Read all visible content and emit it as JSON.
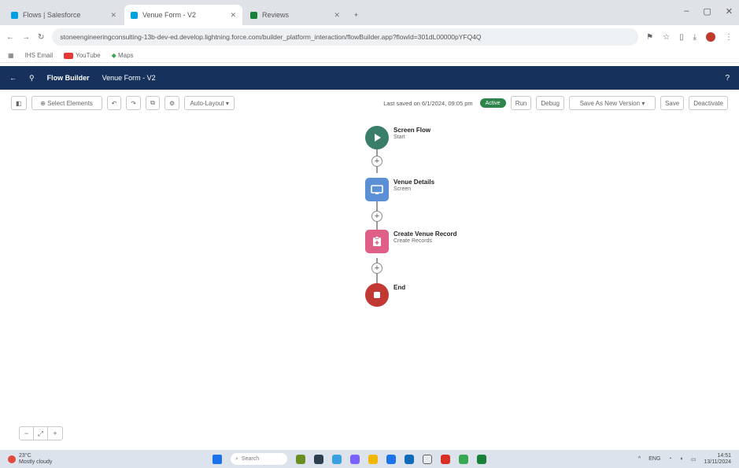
{
  "browser": {
    "tabs": [
      {
        "label": "Flows | Salesforce",
        "active": false
      },
      {
        "label": "Venue Form - V2",
        "active": true
      },
      {
        "label": "Reviews",
        "active": false
      }
    ],
    "new_tab": "+",
    "url": "stoneengineeringconsulting-13b-dev-ed.develop.lightning.force.com/builder_platform_interaction/flowBuilder.app?flowId=301dL00000pYFQ4Q",
    "bookmarks": [
      "IHS Email",
      "YouTube",
      "Maps"
    ]
  },
  "flow_builder": {
    "app_name": "Flow Builder",
    "flow_name": "Venue Form - V2",
    "help": "?"
  },
  "toolbar": {
    "select_elements": "Select Elements",
    "auto_layout": "Auto-Layout",
    "last_saved": "Last saved on 6/1/2024, 09:05 pm",
    "status": "Active",
    "run": "Run",
    "debug": "Debug",
    "save_as": "Save As New Version",
    "save": "Save",
    "deactivate": "Deactivate"
  },
  "canvas": {
    "nodes": [
      {
        "label": "Screen Flow",
        "sub": "Start"
      },
      {
        "label": "Venue Details",
        "sub": "Screen"
      },
      {
        "label": "Create Venue Record",
        "sub": "Create Records"
      },
      {
        "label": "End",
        "sub": ""
      }
    ],
    "zoom_controls": [
      "−",
      "⤢",
      "+"
    ]
  },
  "taskbar": {
    "temperature": "23°C",
    "weather": "Mostly cloudy",
    "search": "Search",
    "language": "ENG",
    "time": "14:51",
    "date": "13/11/2024"
  },
  "colors": {
    "header": "#16325c",
    "start": "#3b7d6b",
    "screen": "#5b8fd6",
    "create": "#e05f87",
    "end": "#c23934",
    "active": "#2e844a"
  }
}
